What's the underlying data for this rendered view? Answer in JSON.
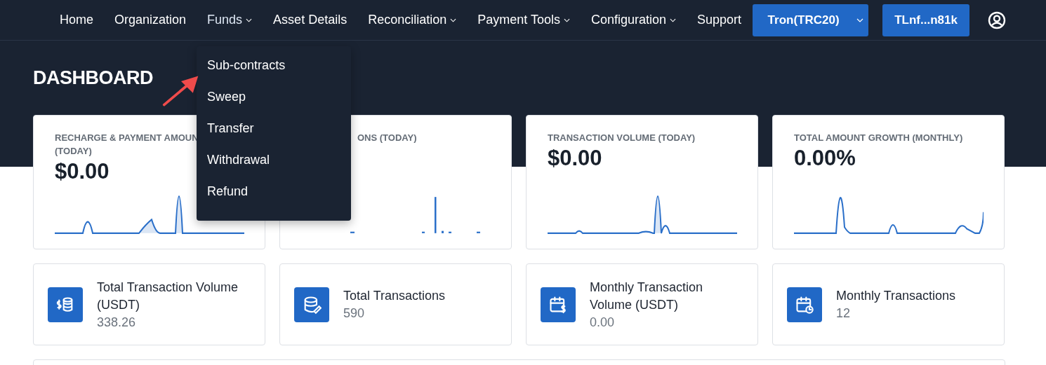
{
  "nav": {
    "items": [
      {
        "label": "Home",
        "kind": "link",
        "expanded": false
      },
      {
        "label": "Organization",
        "kind": "link",
        "expanded": false
      },
      {
        "label": "Funds",
        "kind": "dropdown",
        "expanded": true,
        "menu": [
          "Sub-contracts",
          "Sweep",
          "Transfer",
          "Withdrawal",
          "Refund"
        ]
      },
      {
        "label": "Asset Details",
        "kind": "link",
        "expanded": false
      },
      {
        "label": "Reconciliation",
        "kind": "dropdown",
        "expanded": false
      },
      {
        "label": "Payment Tools",
        "kind": "dropdown",
        "expanded": false
      },
      {
        "label": "Configuration",
        "kind": "dropdown",
        "expanded": false
      },
      {
        "label": "Support",
        "kind": "link",
        "expanded": false
      }
    ],
    "network": "Tron(TRC20)",
    "wallet": "TLnf...n81k"
  },
  "page_title": "DASHBOARD",
  "stat_cards": [
    {
      "title": [
        "RECHARGE & PAYMENT AMOUN",
        "(TODAY)"
      ],
      "value": "$0.00"
    },
    {
      "title": [
        "ONS (TODAY)"
      ]
    },
    {
      "title": [
        "TRANSACTION VOLUME (TODAY)"
      ],
      "value": "$0.00"
    },
    {
      "title": [
        "TOTAL AMOUNT GROWTH (MONTHLY)"
      ],
      "value": "0.00%"
    }
  ],
  "summary_cards": [
    {
      "label": "Total Transaction Volume (USDT)",
      "value": "338.26"
    },
    {
      "label": "Total Transactions",
      "value": "590"
    },
    {
      "label": "Monthly Transaction Volume (USDT)",
      "value": "0.00"
    },
    {
      "label": "Monthly Transactions",
      "value": "12"
    }
  ]
}
